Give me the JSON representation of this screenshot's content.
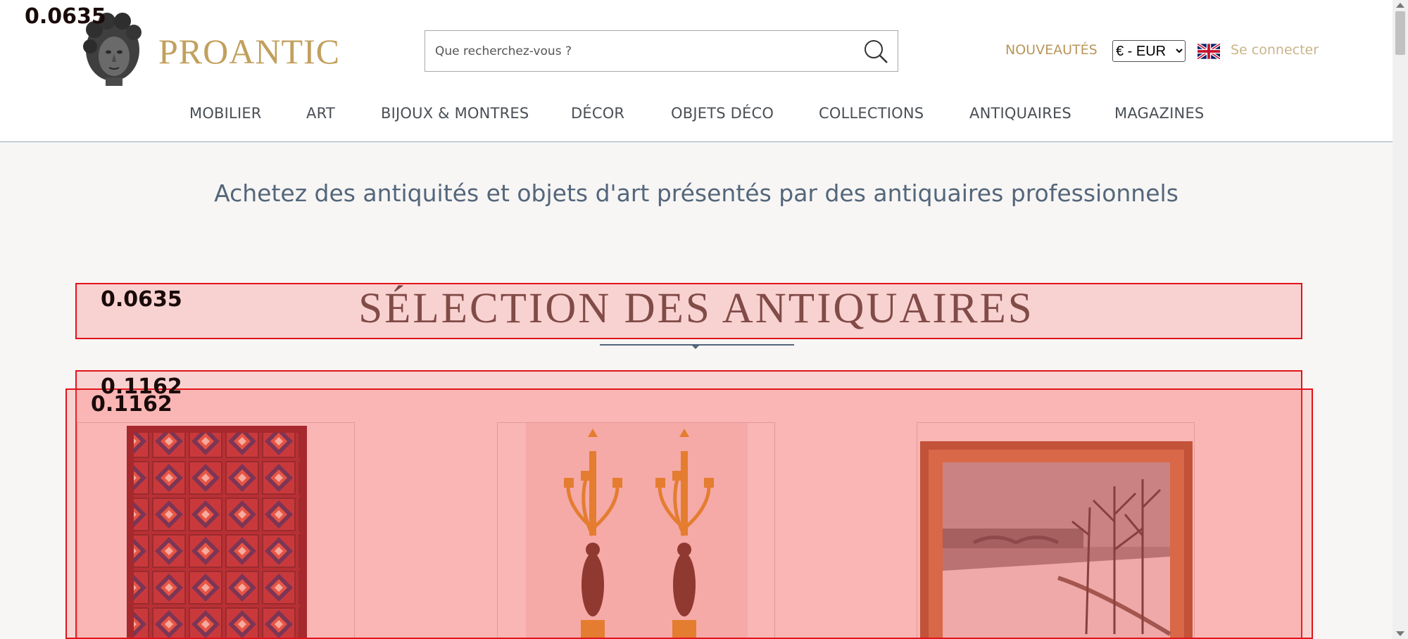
{
  "header": {
    "brand": "PROANTIC",
    "search_placeholder": "Que recherchez-vous ?",
    "new_link": "NOUVEAUTÉS",
    "currency_selected": "€ - EUR",
    "login": "Se connecter",
    "icons": {
      "search": "search-icon",
      "flag": "uk-flag-icon",
      "logo": "sculpture-head-logo"
    }
  },
  "nav": {
    "items": [
      "MOBILIER",
      "ART",
      "BIJOUX & MONTRES",
      "DÉCOR",
      "OBJETS DÉCO",
      "COLLECTIONS",
      "ANTIQUAIRES",
      "MAGAZINES"
    ]
  },
  "main": {
    "tagline": "Achetez des antiquités et objets d'art présentés par des antiquaires professionnels",
    "selection_title": "SÉLECTION DES ANTIQUAIRES",
    "products": [
      {
        "image": "persian-rug-image"
      },
      {
        "image": "ormolu-candelabra-pair-image"
      },
      {
        "image": "framed-winter-landscape-painting-image"
      }
    ]
  },
  "overlay": {
    "corner_label": "0.0635",
    "title_label": "0.0635",
    "band_label_1": "0.1162",
    "band_label_2": "0.1162"
  },
  "colors": {
    "brand_gold": "#c1a05e",
    "nav_text": "#4a4f55",
    "tagline": "#54667a",
    "overlay_red": "#e3131a"
  }
}
